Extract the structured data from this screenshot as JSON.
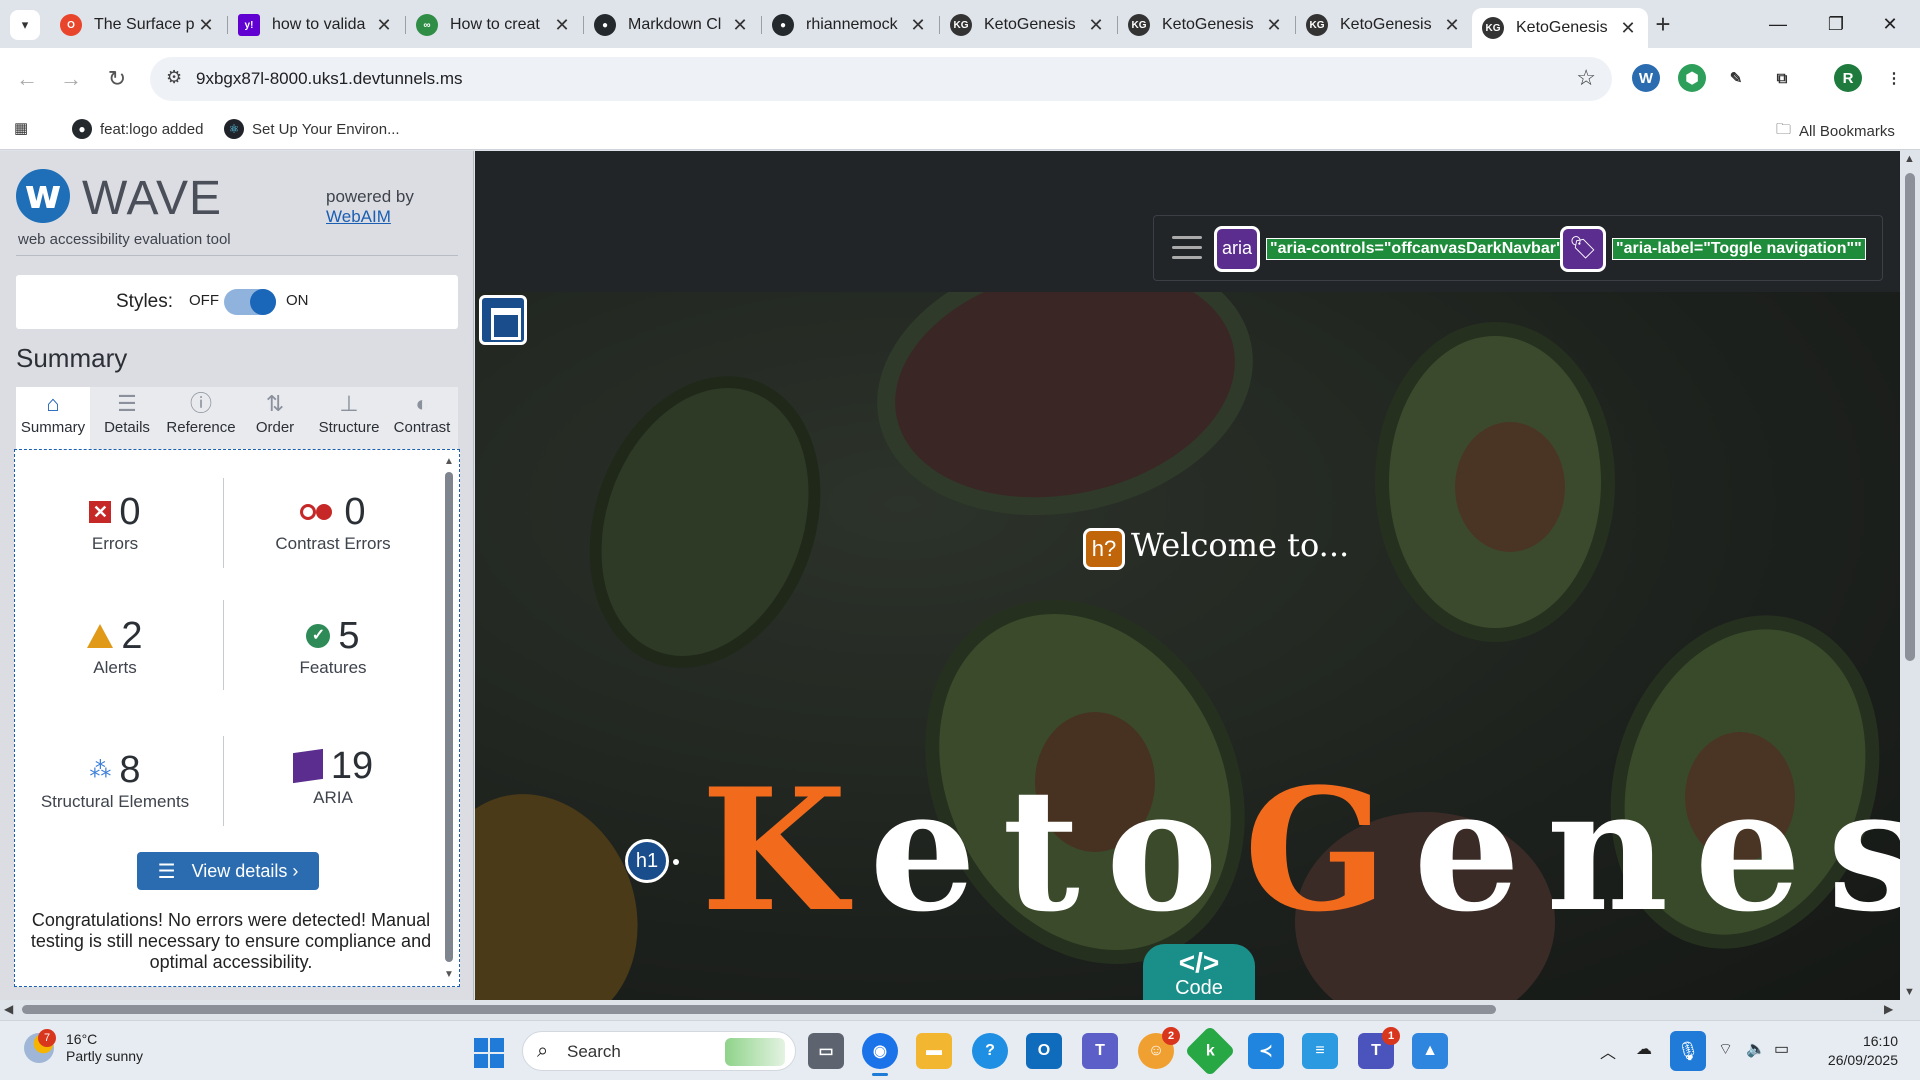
{
  "browser": {
    "tabs": [
      {
        "label": "The Surface p",
        "favicon": "opera-icon",
        "color": "#e8452c"
      },
      {
        "label": "how to valida",
        "favicon": "yahoo-icon",
        "color": "#6001d2"
      },
      {
        "label": "How to creat",
        "favicon": "geeks-icon",
        "color": "#2f8d46"
      },
      {
        "label": "Markdown Cl",
        "favicon": "github-icon",
        "color": "#24292e"
      },
      {
        "label": "rhiannemock",
        "favicon": "github-icon",
        "color": "#24292e"
      },
      {
        "label": "KetoGenesis",
        "favicon": "kg-icon",
        "color": "#333333"
      },
      {
        "label": "KetoGenesis",
        "favicon": "kg-icon",
        "color": "#333333"
      },
      {
        "label": "KetoGenesis",
        "favicon": "kg-icon",
        "color": "#333333"
      },
      {
        "label": "KetoGenesis",
        "favicon": "kg-icon",
        "color": "#333333"
      }
    ],
    "fav_text": "KG",
    "url": "9xbgx87l-8000.uks1.devtunnels.ms",
    "profile_initial": "R",
    "bookmarks": [
      {
        "label": "feat:logo added",
        "icon": "github-icon"
      },
      {
        "label": "Set Up Your Environ...",
        "icon": "react-icon"
      }
    ],
    "all_bookmarks": "All Bookmarks"
  },
  "wave": {
    "title": "WAVE",
    "subtitle": "web accessibility evaluation tool",
    "powered_by": "powered by",
    "webaim": "WebAIM",
    "styles_label": "Styles:",
    "styles_off": "OFF",
    "styles_on": "ON",
    "styles_enabled": true,
    "summary_heading": "Summary",
    "tabs": [
      {
        "label": "Summary",
        "icon": "home-icon",
        "glyph": "⌂"
      },
      {
        "label": "Details",
        "icon": "list-icon",
        "glyph": "☰"
      },
      {
        "label": "Reference",
        "icon": "info-icon",
        "glyph": "ⓘ"
      },
      {
        "label": "Order",
        "icon": "order-icon",
        "glyph": "⇅"
      },
      {
        "label": "Structure",
        "icon": "structure-icon",
        "glyph": "⊥"
      },
      {
        "label": "Contrast",
        "icon": "contrast-icon",
        "glyph": "◐"
      }
    ],
    "stats": {
      "errors": {
        "value": "0",
        "label": "Errors"
      },
      "contrast": {
        "value": "0",
        "label": "Contrast Errors"
      },
      "alerts": {
        "value": "2",
        "label": "Alerts"
      },
      "features": {
        "value": "5",
        "label": "Features"
      },
      "structural": {
        "value": "8",
        "label": "Structural Elements"
      },
      "aria": {
        "value": "19",
        "label": "ARIA"
      }
    },
    "view_details": "View details ›",
    "congrats": "Congratulations! No errors were detected! Manual testing is still necessary to ensure compliance and optimal accessibility."
  },
  "page": {
    "aria_badge": "aria",
    "aria_controls": "\"aria-controls=\"offcanvasDarkNavbar\"\"",
    "aria_label": "\"aria-label=\"Toggle navigation\"\"",
    "h_badge": "h?",
    "welcome": "Welcome to...",
    "h1_badge": "h1",
    "brand_k": "K",
    "brand_eto": "eto",
    "brand_g": "G",
    "brand_enesis": "enesis",
    "code_icon": "</>",
    "code_label": "Code",
    "accent_color": "#f26b1d"
  },
  "taskbar": {
    "weather_badge": "7",
    "temperature": "16°C",
    "condition": "Partly sunny",
    "search": "Search",
    "apps": [
      {
        "icon": "task-view-icon",
        "color": "#5d6470"
      },
      {
        "icon": "chrome-icon",
        "color": "#1a73e8"
      },
      {
        "icon": "file-explorer-icon",
        "color": "#f2b631"
      },
      {
        "icon": "help-icon",
        "color": "#1f8fe3"
      },
      {
        "icon": "outlook-icon",
        "color": "#0f6cbd"
      },
      {
        "icon": "teams-icon",
        "color": "#5b5fc7"
      },
      {
        "icon": "discord-icon",
        "color": "#f0a030"
      },
      {
        "icon": "k-app-icon",
        "color": "#28a745"
      },
      {
        "icon": "vscode-icon",
        "color": "#1f85de"
      },
      {
        "icon": "notepad-icon",
        "color": "#2b9ae0"
      },
      {
        "icon": "teams-work-icon",
        "color": "#4b53bc"
      },
      {
        "icon": "photos-icon",
        "color": "#2e86de"
      }
    ],
    "discord_badge": "2",
    "teams_badge": "1",
    "time": "16:10",
    "date": "26/09/2025"
  }
}
